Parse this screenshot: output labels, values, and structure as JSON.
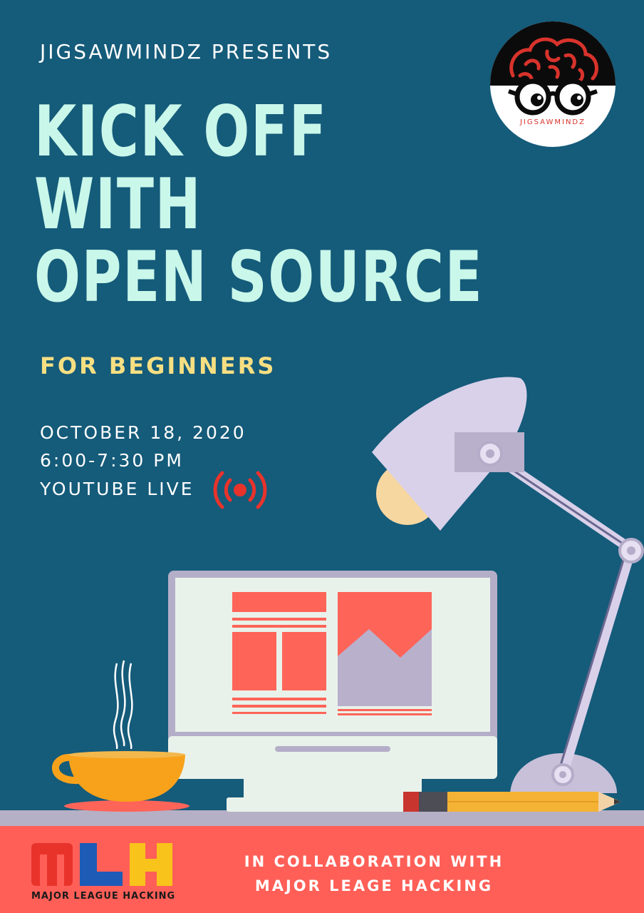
{
  "header": {
    "presents": "JIGSAWMINDZ PRESENTS"
  },
  "title": {
    "line1": "KICK OFF",
    "line2": "WITH",
    "line3": "OPEN SOURCE"
  },
  "subtitle": "FOR BEGINNERS",
  "event": {
    "date": "OCTOBER 18, 2020",
    "time": "6:00-7:30 PM",
    "platform": "YOUTUBE LIVE",
    "live_icon": "broadcast-icon"
  },
  "logo": {
    "text": "JIGSAWMINDZ",
    "icon": "brain-glasses-logo"
  },
  "footer": {
    "mlh_letters": "MLH",
    "mlh_name": "MAJOR LEAGUE HACKING",
    "collab_line1": "IN COLLABORATION WITH",
    "collab_line2": "MAJOR LEAGE HACKING"
  },
  "colors": {
    "background": "#155b7a",
    "title": "#c9f7ea",
    "subtitle": "#f6df82",
    "footer": "#ff5f57",
    "accent_red": "#ff6459",
    "lamp": "#d9d1ea"
  }
}
